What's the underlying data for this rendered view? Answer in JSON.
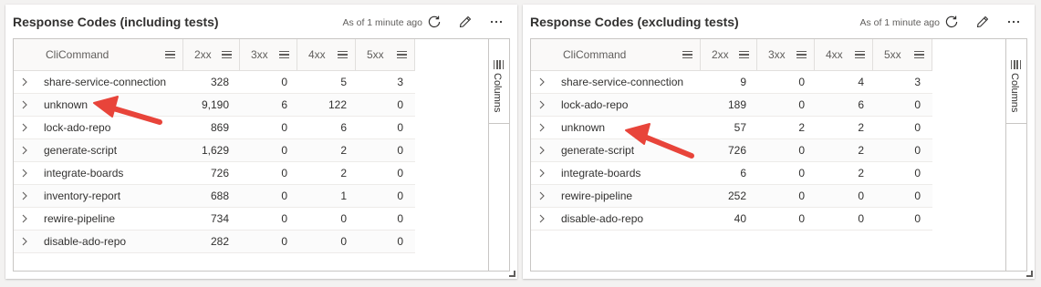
{
  "widgets": [
    {
      "title": "Response Codes (including tests)",
      "as_of": "As of 1 minute ago",
      "columns_label": "Columns",
      "headers": [
        "CliCommand",
        "2xx",
        "3xx",
        "4xx",
        "5xx"
      ],
      "rows": [
        {
          "cmd": "share-service-connection",
          "c2xx": "328",
          "c3xx": "0",
          "c4xx": "5",
          "c5xx": "3"
        },
        {
          "cmd": "unknown",
          "c2xx": "9,190",
          "c3xx": "6",
          "c4xx": "122",
          "c5xx": "0"
        },
        {
          "cmd": "lock-ado-repo",
          "c2xx": "869",
          "c3xx": "0",
          "c4xx": "6",
          "c5xx": "0"
        },
        {
          "cmd": "generate-script",
          "c2xx": "1,629",
          "c3xx": "0",
          "c4xx": "2",
          "c5xx": "0"
        },
        {
          "cmd": "integrate-boards",
          "c2xx": "726",
          "c3xx": "0",
          "c4xx": "2",
          "c5xx": "0"
        },
        {
          "cmd": "inventory-report",
          "c2xx": "688",
          "c3xx": "0",
          "c4xx": "1",
          "c5xx": "0"
        },
        {
          "cmd": "rewire-pipeline",
          "c2xx": "734",
          "c3xx": "0",
          "c4xx": "0",
          "c5xx": "0"
        },
        {
          "cmd": "disable-ado-repo",
          "c2xx": "282",
          "c3xx": "0",
          "c4xx": "0",
          "c5xx": "0"
        }
      ]
    },
    {
      "title": "Response Codes (excluding tests)",
      "as_of": "As of 1 minute ago",
      "columns_label": "Columns",
      "headers": [
        "CliCommand",
        "2xx",
        "3xx",
        "4xx",
        "5xx"
      ],
      "rows": [
        {
          "cmd": "share-service-connection",
          "c2xx": "9",
          "c3xx": "0",
          "c4xx": "4",
          "c5xx": "3"
        },
        {
          "cmd": "lock-ado-repo",
          "c2xx": "189",
          "c3xx": "0",
          "c4xx": "6",
          "c5xx": "0"
        },
        {
          "cmd": "unknown",
          "c2xx": "57",
          "c3xx": "2",
          "c4xx": "2",
          "c5xx": "0"
        },
        {
          "cmd": "generate-script",
          "c2xx": "726",
          "c3xx": "0",
          "c4xx": "2",
          "c5xx": "0"
        },
        {
          "cmd": "integrate-boards",
          "c2xx": "6",
          "c3xx": "0",
          "c4xx": "2",
          "c5xx": "0"
        },
        {
          "cmd": "rewire-pipeline",
          "c2xx": "252",
          "c3xx": "0",
          "c4xx": "0",
          "c5xx": "0"
        },
        {
          "cmd": "disable-ado-repo",
          "c2xx": "40",
          "c3xx": "0",
          "c4xx": "0",
          "c5xx": "0"
        }
      ]
    }
  ],
  "icons": {
    "refresh": "refresh-icon",
    "edit": "pencil-icon",
    "more": "more-options-icon",
    "expand": "chevron-right-icon",
    "column_menu": "column-menu-icon",
    "columns_panel": "columns-icon"
  },
  "colors": {
    "annotation_arrow": "#e8443a",
    "page_background": "#f3f2f1",
    "tile_background": "#ffffff"
  }
}
